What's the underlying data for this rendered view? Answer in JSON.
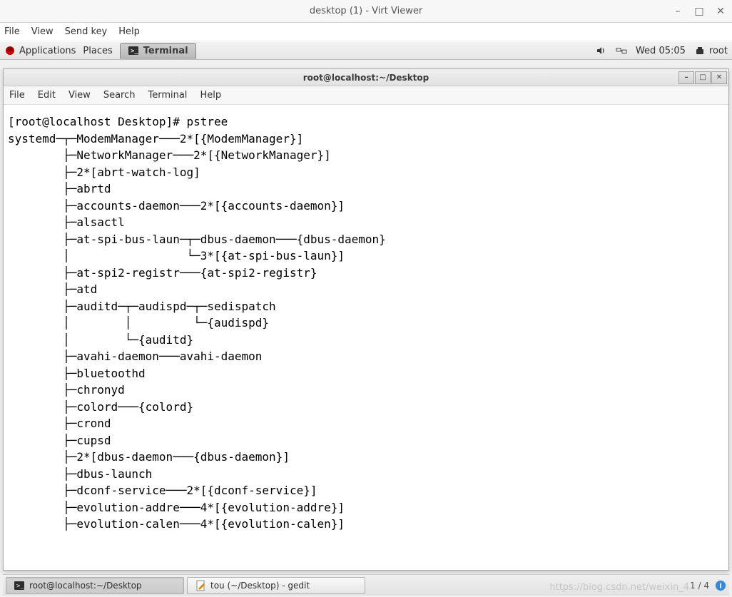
{
  "virt": {
    "title": "desktop (1) - Virt Viewer",
    "menu": [
      "File",
      "View",
      "Send key",
      "Help"
    ]
  },
  "gnome_panel": {
    "applications": "Applications",
    "places": "Places",
    "active_task": "Terminal",
    "clock": "Wed 05:05",
    "user": "root"
  },
  "terminal": {
    "title": "root@localhost:~/Desktop",
    "menu": [
      "File",
      "Edit",
      "View",
      "Search",
      "Terminal",
      "Help"
    ],
    "prompt": "[root@localhost Desktop]# ",
    "command": "pstree",
    "output": "systemd─┬─ModemManager───2*[{ModemManager}]\n        ├─NetworkManager───2*[{NetworkManager}]\n        ├─2*[abrt-watch-log]\n        ├─abrtd\n        ├─accounts-daemon───2*[{accounts-daemon}]\n        ├─alsactl\n        ├─at-spi-bus-laun─┬─dbus-daemon───{dbus-daemon}\n        │                 └─3*[{at-spi-bus-laun}]\n        ├─at-spi2-registr───{at-spi2-registr}\n        ├─atd\n        ├─auditd─┬─audispd─┬─sedispatch\n        │        │         └─{audispd}\n        │        └─{auditd}\n        ├─avahi-daemon───avahi-daemon\n        ├─bluetoothd\n        ├─chronyd\n        ├─colord───{colord}\n        ├─crond\n        ├─cupsd\n        ├─2*[dbus-daemon───{dbus-daemon}]\n        ├─dbus-launch\n        ├─dconf-service───2*[{dconf-service}]\n        ├─evolution-addre───4*[{evolution-addre}]\n        ├─evolution-calen───4*[{evolution-calen}]"
  },
  "taskbar": {
    "items": [
      {
        "label": "root@localhost:~/Desktop",
        "icon": "terminal"
      },
      {
        "label": "tou (~/Desktop) - gedit",
        "icon": "gedit"
      }
    ],
    "workspace": "1 / 4"
  },
  "watermark": "https://blog.csdn.net/weixin_4"
}
